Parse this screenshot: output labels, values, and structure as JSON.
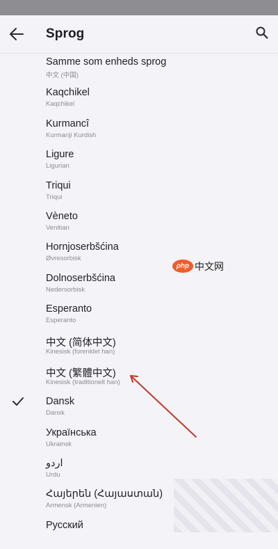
{
  "header": {
    "title": "Sprog",
    "back_icon": "arrow-back-icon",
    "search_icon": "search-icon"
  },
  "languages": [
    {
      "name": "Samme som enheds sprog",
      "subtitle": "中文 (中国)",
      "selected": false
    },
    {
      "name": "Kaqchikel",
      "subtitle": "Kaqchikel",
      "selected": false
    },
    {
      "name": "Kurmancî",
      "subtitle": "Kurmanji Kurdish",
      "selected": false
    },
    {
      "name": "Ligure",
      "subtitle": "Ligurian",
      "selected": false
    },
    {
      "name": "Triqui",
      "subtitle": "Triqui",
      "selected": false
    },
    {
      "name": "Vèneto",
      "subtitle": "Venitian",
      "selected": false
    },
    {
      "name": "Hornjoserbšćina",
      "subtitle": "Øvresorbisk",
      "selected": false
    },
    {
      "name": "Dolnoserbšćina",
      "subtitle": "Nedersorbisk",
      "selected": false
    },
    {
      "name": "Esperanto",
      "subtitle": "Esperanto",
      "selected": false
    },
    {
      "name": "中文 (简体中文)",
      "subtitle": "Kinesisk (forenklet han)",
      "selected": false
    },
    {
      "name": "中文 (繁體中文)",
      "subtitle": "Kinesisk (traditionelt han)",
      "selected": false
    },
    {
      "name": "Dansk",
      "subtitle": "Dansk",
      "selected": true
    },
    {
      "name": "Українська",
      "subtitle": "Ukrainsk",
      "selected": false
    },
    {
      "name": "اردو",
      "subtitle": "Urdu",
      "selected": false
    },
    {
      "name": "Հայերեն (Հայաստան)",
      "subtitle": "Armensk (Armenien)",
      "selected": false
    },
    {
      "name": "Русский",
      "subtitle": "",
      "selected": false
    }
  ],
  "watermark": {
    "logo": "php",
    "text": "中文网"
  },
  "colors": {
    "accent": "#1d1c22",
    "annotation_arrow": "#c0392b",
    "background": "#f4f3f8"
  }
}
